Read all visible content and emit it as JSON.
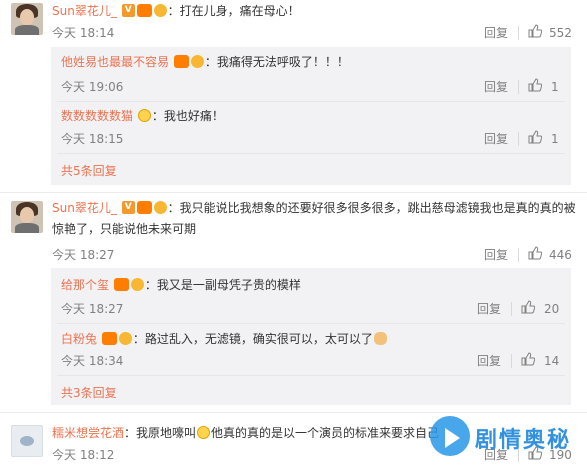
{
  "comments": [
    {
      "user": "Sun翠花儿_",
      "text": "：打在儿身，痛在母心！",
      "time": "今天 18:14",
      "reply_label": "回复",
      "likes": "552"
    },
    {
      "user": "Sun翠花儿_",
      "text_line1": "：我只能说比我想象的还要好很多很多很多，跳出慈母滤镜我也是真的真的被",
      "text_line2": "惊艳了，只能说他未来可期",
      "time": "今天 18:27",
      "reply_label": "回复",
      "likes": "446"
    },
    {
      "user": "糯米想尝花酒",
      "text": "：我原地嚎叫",
      "text_after": "他真的真的是以一个演员的标准来要求自己",
      "time": "今天 18:12",
      "reply_label": "回复",
      "likes": "190"
    }
  ],
  "replies_a": [
    {
      "user": "他姓易也最最不容易",
      "text": "：我痛得无法呼吸了！！！",
      "time": "今天 19:06",
      "reply_label": "回复",
      "likes": "1"
    },
    {
      "user": "数数数数数猫",
      "text": "：我也好痛！",
      "time": "今天 18:15",
      "reply_label": "回复",
      "likes": "1"
    }
  ],
  "replies_a_more": "共5条回复",
  "replies_b": [
    {
      "user": "给那个玺",
      "text": "：我又是一副母凭子贵的模样",
      "time": "今天 18:27",
      "reply_label": "回复",
      "likes": "20"
    },
    {
      "user": "白粉兔",
      "text": "：路过乱入，无滤镜，确实很可以，太可以了",
      "time": "今天 18:34",
      "reply_label": "回复",
      "likes": "14"
    }
  ],
  "replies_b_more": "共3条回复",
  "watermark": {
    "text": "剧情奥秘"
  },
  "colors": {
    "link": "#eb7350",
    "muted": "#808080",
    "reply_bg": "#f2f2f5"
  }
}
